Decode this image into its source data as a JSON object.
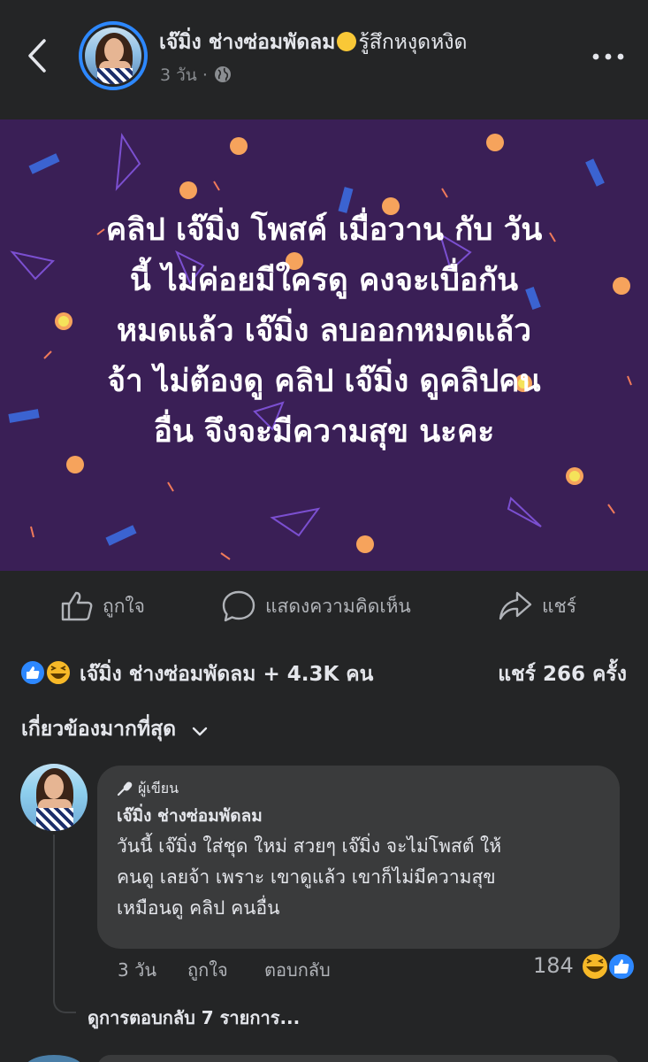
{
  "header": {
    "author_name": "เจ๊มิ่ง ช่างซ่อมพัดลม",
    "feeling": "รู้สึกหงุดหงิด",
    "time": "3 วัน",
    "separator": "·",
    "icons": {
      "back": "chevron-left-icon",
      "privacy": "globe-icon",
      "more": "more-dots-icon"
    }
  },
  "post": {
    "text": "คลิป เจ๊มิ่ง โพสค์ เมื่อวาน กับ วัน นี้ ไม่ค่อยมีใครดู คงจะเบื่อกัน หมดแล้ว เจ๊มิ่ง ลบออกหมดแล้ว จ้า ไม่ต้องดู คลิป เจ๊มิ่ง ดูคลิปคน อื่น จึงจะมีความสุข นะคะ",
    "lines": [
      "คลิป เจ๊มิ่ง โพสค์ เมื่อวาน กับ วัน",
      "นี้ ไม่ค่อยมีใครดู คงจะเบื่อกัน",
      "หมดแล้ว เจ๊มิ่ง ลบออกหมดแล้ว",
      "จ้า ไม่ต้องดู คลิป เจ๊มิ่ง ดูคลิปคน",
      "อื่น จึงจะมีความสุข นะคะ"
    ],
    "background_color": "#3a1f56"
  },
  "actions": {
    "like": "ถูกใจ",
    "comment": "แสดงความคิดเห็น",
    "share": "แชร์"
  },
  "summary": {
    "reactors": "เจ๊มิ่ง ช่างซ่อมพัดลม + 4.3K คน",
    "shares": "แชร์ 266 ครั้ง"
  },
  "filter": {
    "label": "เกี่ยวข้องมากที่สุด"
  },
  "comment": {
    "badge": "ผู้เขียน",
    "author": "เจ๊มิ่ง ช่างซ่อมพัดลม",
    "lines": [
      "วันนี้ เจ๊มิ่ง ใส่ชุด ใหม่ สวยๆ เจ๊มิ่ง จะไม่โพสต์ ให้",
      "คนดู เลยจ้า เพราะ เขาดูแล้ว เขาก็ไม่มีความสุข",
      "เหมือนดู คลิป คนอื่น"
    ],
    "time": "3 วัน",
    "like": "ถูกใจ",
    "reply": "ตอบกลับ",
    "reaction_count": "184",
    "view_replies": "ดูการตอบกลับ 7 รายการ..."
  },
  "colors": {
    "background": "#242526",
    "bubble": "#3a3b3c",
    "accent": "#2d88ff",
    "secondary_text": "#b0b3b8",
    "primary_text": "#e4e6eb"
  }
}
